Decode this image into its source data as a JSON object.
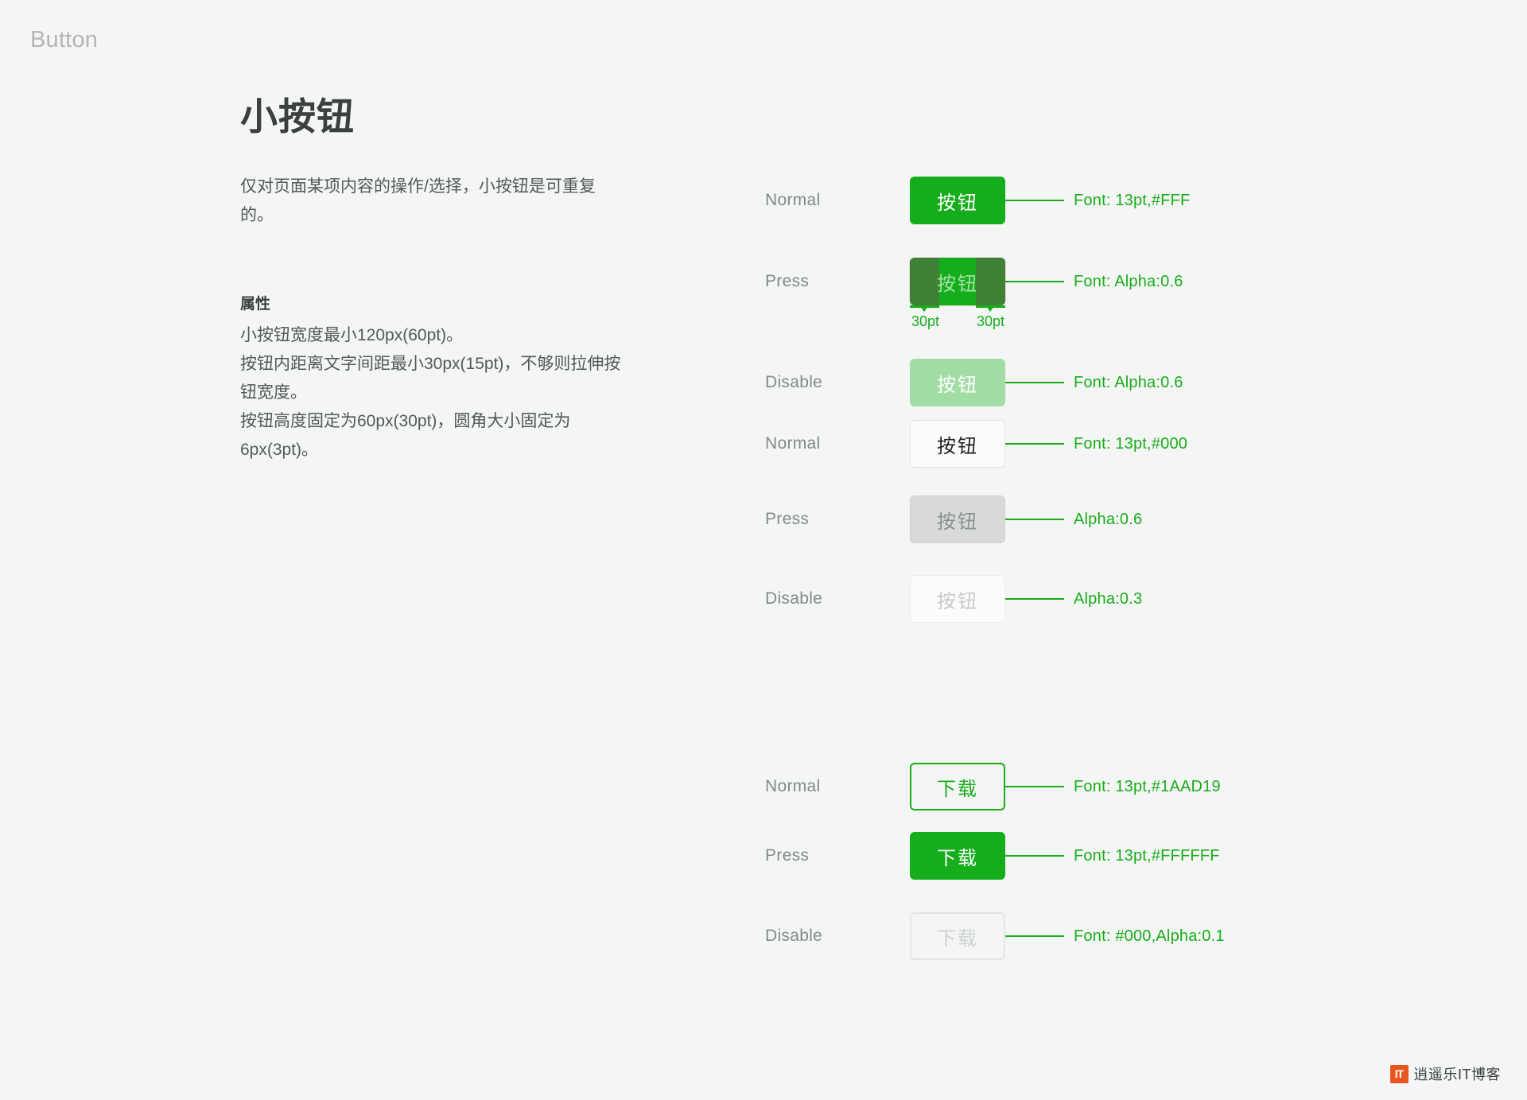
{
  "breadcrumb": "Button",
  "heading": "小按钮",
  "intro": "仅对页面某项内容的操作/选择，小按钮是可重复的。",
  "attributes": {
    "title": "属性",
    "lines": [
      "小按钮宽度最小120px(60pt)。",
      "按钮内距离文字间距最小30px(15pt)，不够则拉伸按钮宽度。",
      "按钮高度固定为60px(30pt)，圆角大小固定为6px(3pt)。"
    ]
  },
  "accent_color": "#1AAD19",
  "groups": [
    {
      "name": "primary-filled",
      "rows": [
        {
          "state": "Normal",
          "button_label": "按钮",
          "annotation": "Font: 13pt,#FFF"
        },
        {
          "state": "Press",
          "button_label": "按钮",
          "annotation": "Font: Alpha:0.6",
          "measure_left": "30pt",
          "measure_right": "30pt"
        },
        {
          "state": "Disable",
          "button_label": "按钮",
          "annotation": "Font: Alpha:0.6"
        }
      ]
    },
    {
      "name": "secondary-white",
      "rows": [
        {
          "state": "Normal",
          "button_label": "按钮",
          "annotation": "Font: 13pt,#000"
        },
        {
          "state": "Press",
          "button_label": "按钮",
          "annotation": "Alpha:0.6"
        },
        {
          "state": "Disable",
          "button_label": "按钮",
          "annotation": "Alpha:0.3"
        }
      ]
    },
    {
      "name": "outline-download",
      "rows": [
        {
          "state": "Normal",
          "button_label": "下载",
          "annotation": "Font: 13pt,#1AAD19"
        },
        {
          "state": "Press",
          "button_label": "下载",
          "annotation": "Font: 13pt,#FFFFFF"
        },
        {
          "state": "Disable",
          "button_label": "下载",
          "annotation": "Font: #000,Alpha:0.1"
        }
      ]
    }
  ],
  "watermark": {
    "mark": "IT",
    "text": "逍遥乐IT博客"
  }
}
